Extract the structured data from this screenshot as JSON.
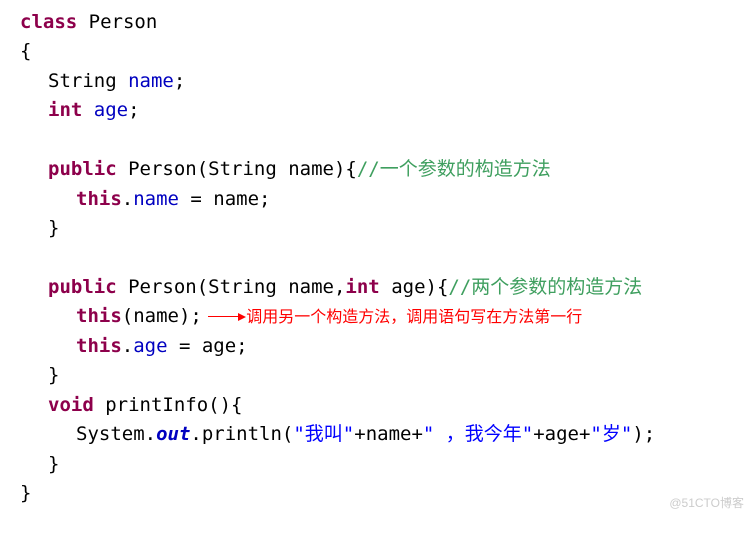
{
  "code": {
    "kw_class": "class",
    "cls_name": " Person",
    "lbrace": "{",
    "rbrace": "}",
    "field1_type": "String ",
    "field1_name": "name",
    "field2_type": "int ",
    "field2_name": "age",
    "semicolon": ";",
    "kw_public": "public",
    "ctor1_sig": " Person(String name){",
    "ctor1_comment": "//一个参数的构造方法",
    "kw_this": "this",
    "ctor1_body_mid": ".",
    "ctor1_body_name": "name",
    "ctor1_body_assign": " = name;",
    "ctor2_sig": " Person(String name,",
    "ctor2_sig_int": "int",
    "ctor2_sig_tail": " age){",
    "ctor2_comment": "//两个参数的构造方法",
    "ctor2_l1_this": "this",
    "ctor2_l1_tail": "(name);",
    "ctor2_l2_this": "this",
    "ctor2_l2_mid": ".",
    "ctor2_l2_age": "age",
    "ctor2_l2_tail": " = age;",
    "m_void": "void",
    "m_sig": " printInfo(){",
    "m_sys": "System.",
    "m_out": "out",
    "m_print": ".println(",
    "m_str1": "\"我叫\"",
    "m_plus": "+name+",
    "m_str2": "\" ，我今年\"",
    "m_plus2": "+age+",
    "m_str3": "\"岁\"",
    "m_end": ");"
  },
  "annotation": "调用另一个构造方法，调用语句写在方法第一行",
  "watermark": "@51CTO博客"
}
